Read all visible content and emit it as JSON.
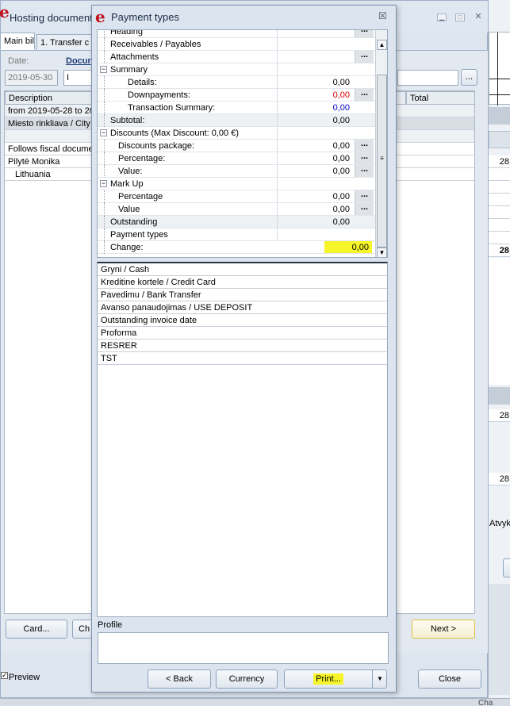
{
  "background_window": {
    "title": "Hosting document",
    "tabs": [
      "Main bill",
      "1. Transfer c"
    ],
    "date_label": "Date:",
    "date_value": "2019-05-30",
    "document_label": "Docur",
    "document_value": "I",
    "browse_label": "...",
    "columns": [
      "Description",
      "Total"
    ],
    "rows": [
      "from 2019-05-28 to 20",
      "Miesto rinkliava / City",
      "",
      "Follows fiscal documer",
      "Pilytė Monika",
      "Lithuania"
    ],
    "card_button": "Card...",
    "ch_button": "Ch",
    "next_button": "Next >",
    "preview_label": "Preview",
    "preview_checked": true
  },
  "right_strip": {
    "values": [
      "28",
      "28",
      "28",
      "28"
    ],
    "atvyk_text": "Atvyk",
    "c_label": "C",
    "bottom_text": "Cha"
  },
  "dialog": {
    "title": "Payment types",
    "close_label": "☒",
    "tree": [
      {
        "label": "Heading",
        "value": "",
        "dots": true,
        "indent": 1
      },
      {
        "label": "Receivables / Payables",
        "value": "",
        "dots": false,
        "indent": 1
      },
      {
        "label": "Attachments",
        "value": "",
        "dots": true,
        "indent": 1
      },
      {
        "label": "Summary",
        "value": "",
        "dots": false,
        "indent": 0,
        "expander": "−"
      },
      {
        "label": "Details:",
        "value": "0,00",
        "dots": false,
        "indent": 2
      },
      {
        "label": "Downpayments:",
        "value": "0,00",
        "dots": true,
        "indent": 2,
        "color": "#d60000"
      },
      {
        "label": "Transaction Summary:",
        "value": "0,00",
        "dots": false,
        "indent": 2,
        "color": "#0000c8"
      },
      {
        "label": "Subtotal:",
        "value": "0,00",
        "dots": false,
        "indent": 1,
        "gray": true
      },
      {
        "label": "Discounts (Max Discount: 0,00 €)",
        "value": "",
        "dots": false,
        "indent": 0,
        "expander": "−"
      },
      {
        "label": "Discounts package:",
        "value": "0,00",
        "dots": true,
        "indent": 3
      },
      {
        "label": "Percentage:",
        "value": "0,00",
        "dots": true,
        "indent": 3
      },
      {
        "label": "Value:",
        "value": "0,00",
        "dots": true,
        "indent": 3
      },
      {
        "label": "Mark Up",
        "value": "",
        "dots": false,
        "indent": 0,
        "expander": "−"
      },
      {
        "label": "Percentage",
        "value": "0,00",
        "dots": true,
        "indent": 3
      },
      {
        "label": "Value",
        "value": "0,00",
        "dots": true,
        "indent": 3
      },
      {
        "label": "Outstanding",
        "value": "0,00",
        "dots": false,
        "indent": 1,
        "gray": true
      },
      {
        "label": "Payment types",
        "value": "",
        "dots": false,
        "indent": 1
      },
      {
        "label": "Change:",
        "value": "0,00",
        "dots": false,
        "indent": 1,
        "highlight": true
      }
    ],
    "payment_types": [
      "Gryni / Cash",
      "Kreditine kortele / Credit Card",
      "Pavedimu / Bank Transfer",
      "Avanso panaudojimas / USE DEPOSIT",
      "Outstanding invoice date",
      "Proforma",
      "RESRER",
      "TST"
    ],
    "profile_label": "Profile",
    "profile_value": "",
    "back_button": "< Back",
    "currency_button": "Currency",
    "print_button": "Print...",
    "close_button": "Close",
    "highlight_color": "#f5f52a"
  }
}
